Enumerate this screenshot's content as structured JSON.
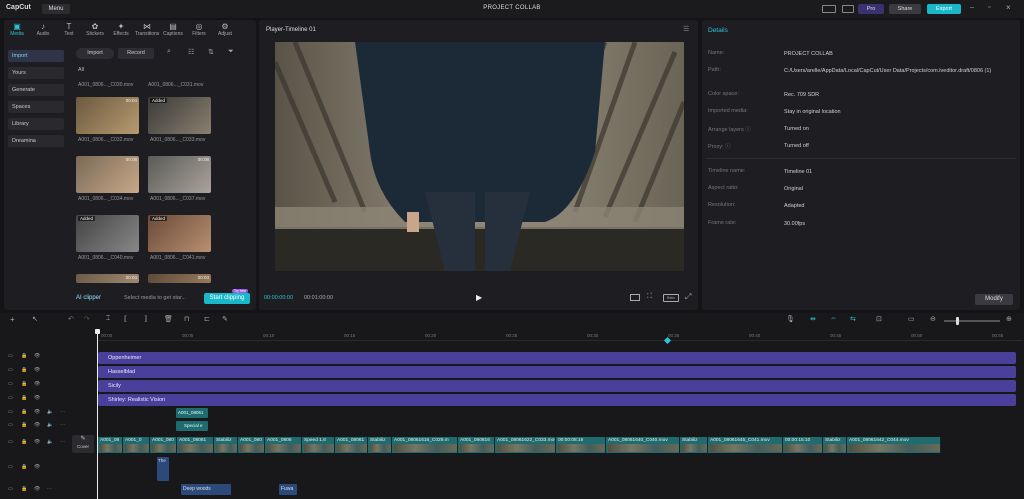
{
  "app": {
    "logo": "CapCut",
    "menu": "Menu",
    "title": "PROJECT COLLAB",
    "pro": "Pro",
    "share": "Share",
    "export": "Export"
  },
  "toolbar": [
    {
      "label": "Media",
      "icon": "media-icon"
    },
    {
      "label": "Audio",
      "icon": "audio-icon"
    },
    {
      "label": "Text",
      "icon": "text-icon"
    },
    {
      "label": "Stickers",
      "icon": "stickers-icon"
    },
    {
      "label": "Effects",
      "icon": "effects-icon"
    },
    {
      "label": "Transitions",
      "icon": "transitions-icon"
    },
    {
      "label": "Captions",
      "icon": "captions-icon"
    },
    {
      "label": "Filters",
      "icon": "filters-icon"
    },
    {
      "label": "Adjust",
      "icon": "adjust-icon"
    }
  ],
  "sidebar": [
    "Import",
    "Yours",
    "Generate",
    "Spaces",
    "Library",
    "Dreamina"
  ],
  "media": {
    "import": "Import",
    "record": "Record",
    "filter_all": "All",
    "top_label": "A001_0806..._C030.mov",
    "top_label2": "A001_0806..._C031.mov",
    "items": [
      {
        "label": "A001_0806..._C032.mov",
        "tag": "",
        "dur": "00:04"
      },
      {
        "label": "A001_0806..._C033.mov",
        "tag": "Added",
        "dur": ""
      },
      {
        "label": "A001_0806..._C034.mov",
        "tag": "",
        "dur": "00:08"
      },
      {
        "label": "A001_0806..._C037.mov",
        "tag": "",
        "dur": "00:08"
      },
      {
        "label": "A001_0806..._C040.mov",
        "tag": "Added",
        "dur": ""
      },
      {
        "label": "A001_0806..._C041.mov",
        "tag": "Added",
        "dur": ""
      },
      {
        "label": "",
        "tag": "",
        "dur": "00:03"
      },
      {
        "label": "",
        "tag": "",
        "dur": "00:03"
      }
    ],
    "ai_clipper": "AI clipper",
    "ai_hint": "Select media to get star...",
    "start_clipping": "Start clipping",
    "free_badge": "Try free"
  },
  "player": {
    "title": "Player-Timeline 01",
    "time_current": "00:00:00:00",
    "time_total": "00:01:00:00",
    "ratio": "Ratio"
  },
  "details": {
    "title": "Details",
    "rows": [
      {
        "k": "Name:",
        "v": "PROJECT COLLAB"
      },
      {
        "k": "Path:",
        "v": "C:/Users/arelle/AppData/Local/CapCut/User Data/Projects/com.lveditor.draft/0806 (1)"
      },
      {
        "k": "Color space:",
        "v": "Rec. 709 SDR"
      },
      {
        "k": "Imported media:",
        "v": "Stay in original location"
      },
      {
        "k": "Arrange layers ⓘ",
        "v": "Turned on"
      },
      {
        "k": "Proxy: ⓘ",
        "v": "Turned off"
      },
      {
        "k": "Timeline name:",
        "v": "Timeline 01"
      },
      {
        "k": "Aspect ratio:",
        "v": "Original"
      },
      {
        "k": "Resolution:",
        "v": "Adapted"
      },
      {
        "k": "Frame rate:",
        "v": "30.00fps"
      }
    ],
    "modify": "Modify"
  },
  "timeline": {
    "ticks": [
      "00:00",
      "00:05",
      "00:10",
      "00:15",
      "00:20",
      "00:25",
      "00:30",
      "00:35",
      "00:40",
      "00:45",
      "00:50",
      "00:55"
    ],
    "effects": [
      "Oppenheimer",
      "Hasselblad",
      "Sicily",
      "Shirley: Realistic Vision"
    ],
    "small_clip": "A001_08061",
    "special": "Special e",
    "cover": "Cover",
    "main_clips": [
      "A001_08",
      "A001_0",
      "A001_080",
      "A001_08061",
      "Stabiliz",
      "A001_080",
      "A001_0806",
      "Speed 1.6",
      "A001_08061",
      "Stabiliz",
      "A001_08061616_C029.m",
      "A001_080616",
      "A001_08061622_C033.mov",
      "00:00:08:16",
      "A001_08061640_C040.mov",
      "Stabiliz",
      "A001_08061645_C041.mov",
      "00:00:15:10",
      "Stabiliz",
      "A001_08061642_C044.mov"
    ],
    "text_clip": "The",
    "audio1": "Deep woods",
    "audio2": "Fuwa"
  }
}
